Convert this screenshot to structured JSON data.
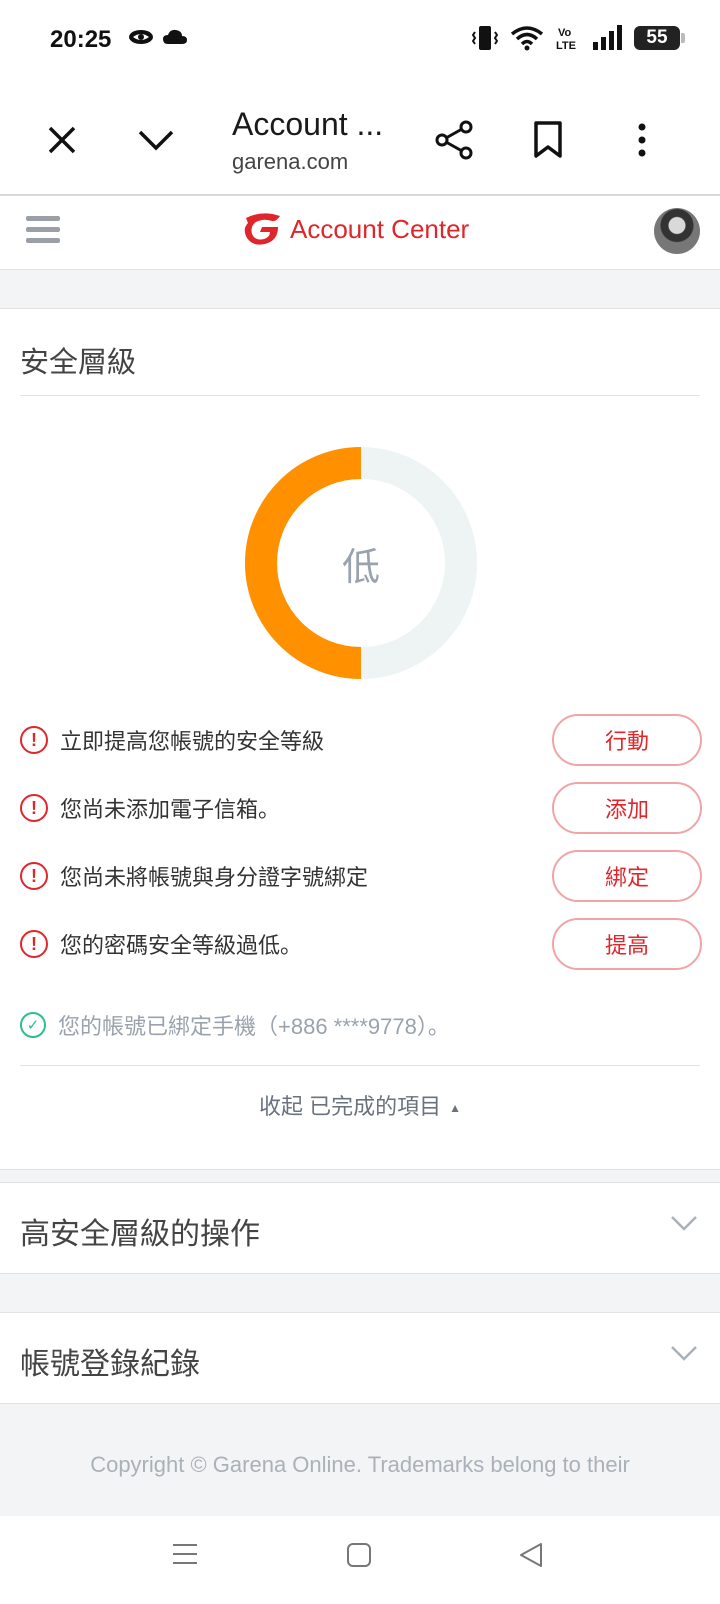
{
  "status_bar": {
    "time": "20:25",
    "battery": "55",
    "left_icons": [
      "notification-icon",
      "cloud-icon"
    ],
    "right_icons": [
      "vibrate-icon",
      "wifi-icon",
      "volte-icon",
      "signal-icon",
      "battery-icon"
    ],
    "volte_label": "Vo LTE"
  },
  "browser": {
    "title": "Account ...",
    "url": "garena.com",
    "buttons": [
      "close-icon",
      "chevron-down-icon",
      "share-icon",
      "bookmark-icon",
      "more-icon"
    ]
  },
  "site_header": {
    "brand": "Account Center",
    "brand_color": "#e0262b"
  },
  "security": {
    "title": "安全層級",
    "level_label": "低",
    "level_fraction": 0.5,
    "progress_color": "#ff9100",
    "track_color": "#eef4f4",
    "issues": [
      {
        "text": "立即提高您帳號的安全等級",
        "action": "行動"
      },
      {
        "text": "您尚未添加電子信箱。",
        "action": "添加"
      },
      {
        "text": "您尚未將帳號與身分證字號綁定",
        "action": "綁定"
      },
      {
        "text": "您的密碼安全等級過低。",
        "action": "提高"
      }
    ],
    "completed": [
      {
        "text": "您的帳號已綁定手機（+886 ****9778）。"
      }
    ],
    "collapse_label": "收起 已完成的項目"
  },
  "sections": {
    "high_security": "高安全層級的操作",
    "login_history": "帳號登錄紀錄"
  },
  "footer": {
    "copyright": "Copyright © Garena Online. Trademarks belong to their"
  }
}
